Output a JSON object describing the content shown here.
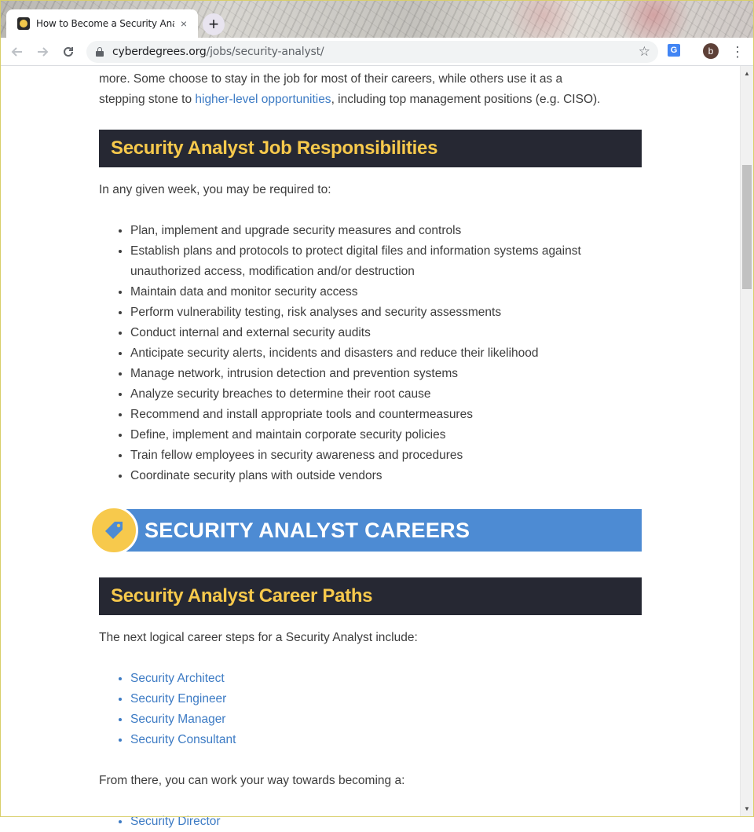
{
  "browser": {
    "tab_title": "How to Become a Security Analyst",
    "tab_close": "×",
    "new_tab": "+",
    "url_domain": "cyberdegrees.org",
    "url_path": "/jobs/security-analyst/",
    "profile_initial": "b"
  },
  "intro": {
    "line1": "more. Some choose to stay in the job for most of their careers, while others use it as a",
    "line2_before": "stepping stone to ",
    "line2_link": "higher-level opportunities",
    "line2_after": ", including top management positions (e.g. CISO)."
  },
  "responsibilities": {
    "heading": "Security Analyst Job Responsibilities",
    "lead": "In any given week, you may be required to:",
    "items": [
      "Plan, implement and upgrade security measures and controls",
      "Establish plans and protocols to protect digital files and information systems against unauthorized access, modification and/or destruction",
      "Maintain data and monitor security access",
      "Perform vulnerability testing, risk analyses and security assessments",
      "Conduct internal and external security audits",
      "Anticipate security alerts, incidents and disasters and reduce their likelihood",
      "Manage network, intrusion detection and prevention systems",
      "Analyze security breaches to determine their root cause",
      "Recommend and install appropriate tools and countermeasures",
      "Define, implement and maintain corporate security policies",
      "Train fellow employees in security awareness and procedures",
      "Coordinate security plans with outside vendors"
    ]
  },
  "careers_banner": {
    "title": "SECURITY ANALYST CAREERS",
    "icon": "tag-icon"
  },
  "career_paths": {
    "heading": "Security Analyst Career Paths",
    "lead": "The next logical career steps for a Security Analyst include:",
    "items": [
      "Security Architect",
      "Security Engineer",
      "Security Manager",
      "Security Consultant"
    ],
    "followup": "From there, you can work your way towards becoming a:",
    "partial_item": "Security Director"
  },
  "colors": {
    "heading_bg": "#262833",
    "heading_text": "#f7c94c",
    "banner_bg": "#4d8bd3",
    "link": "#3d7bc4"
  }
}
